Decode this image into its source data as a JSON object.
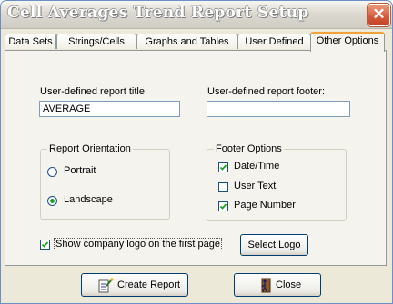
{
  "window": {
    "title": "Cell Averages Trend Report Setup",
    "close_glyph": "✕"
  },
  "tabs": [
    {
      "label": "Data Sets"
    },
    {
      "label": "Strings/Cells"
    },
    {
      "label": "Graphs and Tables"
    },
    {
      "label": "User Defined"
    },
    {
      "label": "Other Options",
      "active": true
    }
  ],
  "report_title": {
    "label": "User-defined report title:",
    "value": "AVERAGE"
  },
  "report_footer": {
    "label": "User-defined report footer:",
    "value": ""
  },
  "orientation": {
    "legend": "Report Orientation",
    "options": [
      {
        "label": "Portrait",
        "checked": false
      },
      {
        "label": "Landscape",
        "checked": true
      }
    ]
  },
  "footer_options": {
    "legend": "Footer Options",
    "items": [
      {
        "label": "Date/Time",
        "checked": true
      },
      {
        "label": "User Text",
        "checked": false
      },
      {
        "label": "Page Number",
        "checked": true
      }
    ]
  },
  "logo": {
    "label": "Show company logo on the first page",
    "checked": true,
    "button": "Select Logo"
  },
  "buttons": {
    "create_report": "Create Report",
    "close_prefix": "C",
    "close_rest": "lose"
  },
  "colors": {
    "tab_highlight": "#f2a43a",
    "close_button": "#d4583a",
    "check_green": "#21a121"
  }
}
